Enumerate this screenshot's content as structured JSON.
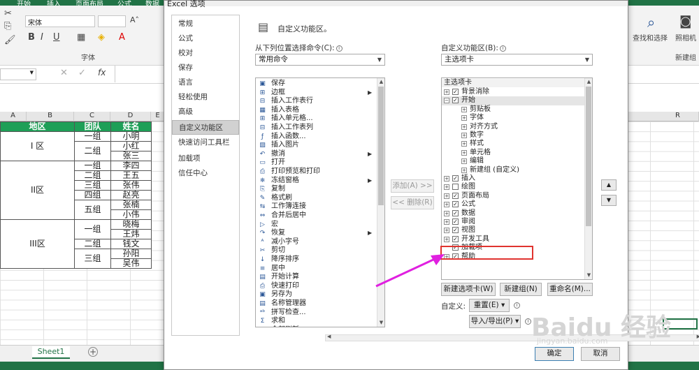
{
  "excel": {
    "ribbon_tabs": [
      "开始",
      "插入",
      "页面布局",
      "公式",
      "数据"
    ],
    "font_name": "宋体",
    "font_group_label": "字体",
    "find_select_label": "查找和选择",
    "photo_label": "照相机",
    "new_group_label": "新建组",
    "column_headers": [
      "A",
      "B",
      "C",
      "D",
      "E",
      "R"
    ],
    "table_headers": [
      "地区",
      "团队",
      "姓名"
    ],
    "regions": [
      "I 区",
      "II区",
      "III区"
    ],
    "teams": [
      "一组",
      "二组",
      "一组",
      "二组",
      "三组",
      "四组",
      "五组",
      "一组",
      "二组",
      "三组"
    ],
    "names": [
      "小明",
      "小红",
      "张三",
      "李四",
      "王五",
      "张伟",
      "赵亮",
      "张楠",
      "小伟",
      "晓梅",
      "王炜",
      "钱文",
      "孙阳",
      "吴伟"
    ],
    "sheet_tab": "Sheet1",
    "add_sheet": "+"
  },
  "dialog": {
    "title": "Excel 选项",
    "nav_items": [
      "常规",
      "公式",
      "校对",
      "保存",
      "语言",
      "轻松使用",
      "高级",
      "自定义功能区",
      "快速访问工具栏",
      "加载项",
      "信任中心"
    ],
    "active_nav": "自定义功能区",
    "heading": "自定义功能区。",
    "choose_from_label": "从下列位置选择命令(C):",
    "choose_from_value": "常用命令",
    "customize_label": "自定义功能区(B):",
    "customize_value": "主选项卡",
    "commands": [
      "保存",
      "边框",
      "插入工作表行",
      "插入表格",
      "插入单元格...",
      "插入工作表列",
      "插入函数...",
      "插入图片",
      "撤消",
      "打开",
      "打印预览和打印",
      "冻结窗格",
      "复制",
      "格式刷",
      "工作簿连接",
      "合并后居中",
      "宏",
      "恢复",
      "减小字号",
      "剪切",
      "降序排序",
      "居中",
      "开始计算",
      "快速打印",
      "另存为",
      "名称管理器",
      "拼写检查...",
      "求和",
      "全部刷新"
    ],
    "add_button": "添加(A) >>",
    "remove_button": "<< 删除(R)",
    "tree_header": "主选项卡",
    "tree": [
      {
        "label": "背景消除",
        "level": 1,
        "expander": "+",
        "checked": true
      },
      {
        "label": "开始",
        "level": 1,
        "expander": "−",
        "checked": true,
        "selected": true
      },
      {
        "label": "剪贴板",
        "level": 2,
        "expander": "+"
      },
      {
        "label": "字体",
        "level": 2,
        "expander": "+"
      },
      {
        "label": "对齐方式",
        "level": 2,
        "expander": "+"
      },
      {
        "label": "数字",
        "level": 2,
        "expander": "+"
      },
      {
        "label": "样式",
        "level": 2,
        "expander": "+"
      },
      {
        "label": "单元格",
        "level": 2,
        "expander": "+"
      },
      {
        "label": "编辑",
        "level": 2,
        "expander": "+"
      },
      {
        "label": "新建组 (自定义)",
        "level": 2,
        "expander": "+"
      },
      {
        "label": "插入",
        "level": 1,
        "expander": "+",
        "checked": true
      },
      {
        "label": "绘图",
        "level": 1,
        "expander": "+",
        "checked": false
      },
      {
        "label": "页面布局",
        "level": 1,
        "expander": "+",
        "checked": true
      },
      {
        "label": "公式",
        "level": 1,
        "expander": "+",
        "checked": true
      },
      {
        "label": "数据",
        "level": 1,
        "expander": "+",
        "checked": true
      },
      {
        "label": "审阅",
        "level": 1,
        "expander": "+",
        "checked": true
      },
      {
        "label": "视图",
        "level": 1,
        "expander": "+",
        "checked": true
      },
      {
        "label": "开发工具",
        "level": 1,
        "expander": "+",
        "checked": true,
        "highlighted": true
      },
      {
        "label": "加载项",
        "level": 1,
        "expander": "",
        "checked": true
      },
      {
        "label": "帮助",
        "level": 1,
        "expander": "+",
        "checked": true
      }
    ],
    "new_tab_button": "新建选项卡(W)",
    "new_group_button": "新建组(N)",
    "rename_button": "重命名(M)...",
    "customizations_label": "自定义:",
    "reset_button": "重置(E) ▾",
    "import_export_button": "导入/导出(P) ▾",
    "move_up": "▲",
    "move_down": "▼",
    "ok_button": "确定",
    "cancel_button": "取消"
  },
  "watermark": {
    "text": "Baidu 经验",
    "sub": "jingyan.baidu.com"
  },
  "colors": {
    "excel_green": "#217346",
    "header_green": "#1e9f57",
    "highlight_red": "#e0342f",
    "arrow_magenta": "#e020e0"
  }
}
